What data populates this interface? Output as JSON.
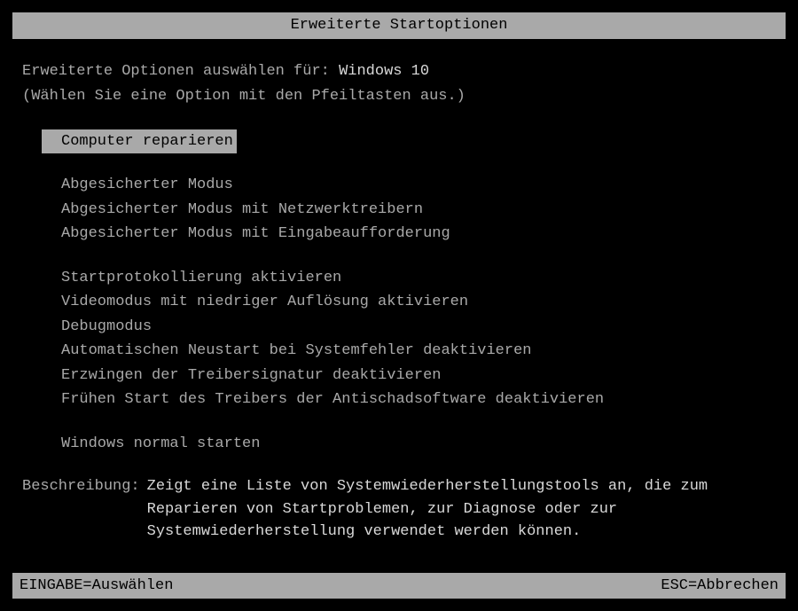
{
  "title": "Erweiterte Startoptionen",
  "header": {
    "prefix": "Erweiterte Optionen auswählen für:",
    "os_name": "Windows 10",
    "instruction": "(Wählen Sie eine Option mit den Pfeiltasten aus.)"
  },
  "menu": {
    "group1": [
      "Computer reparieren"
    ],
    "group2": [
      "Abgesicherter Modus",
      "Abgesicherter Modus mit Netzwerktreibern",
      "Abgesicherter Modus mit Eingabeaufforderung"
    ],
    "group3": [
      "Startprotokollierung aktivieren",
      "Videomodus mit niedriger Auflösung aktivieren",
      "Debugmodus",
      "Automatischen Neustart bei Systemfehler deaktivieren",
      "Erzwingen der Treibersignatur deaktivieren",
      "Frühen Start des Treibers der Antischadsoftware deaktivieren"
    ],
    "group4": [
      "Windows normal starten"
    ]
  },
  "description": {
    "label": "Beschreibung:",
    "text": "Zeigt eine Liste von Systemwiederherstellungstools an, die zum Reparieren von Startproblemen, zur Diagnose oder zur Systemwiederherstellung verwendet werden können."
  },
  "footer": {
    "left": "EINGABE=Auswählen",
    "right": "ESC=Abbrechen"
  }
}
